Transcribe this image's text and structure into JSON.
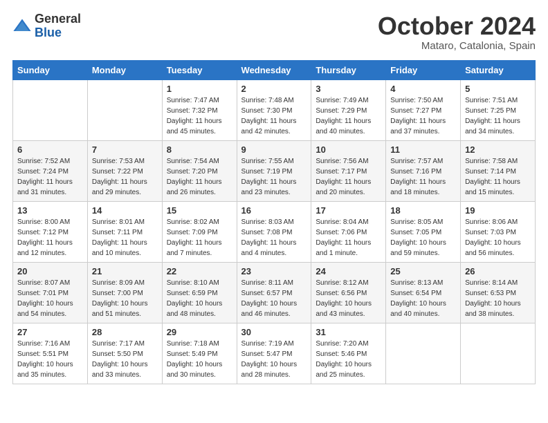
{
  "logo": {
    "general": "General",
    "blue": "Blue"
  },
  "header": {
    "month": "October 2024",
    "location": "Mataro, Catalonia, Spain"
  },
  "weekdays": [
    "Sunday",
    "Monday",
    "Tuesday",
    "Wednesday",
    "Thursday",
    "Friday",
    "Saturday"
  ],
  "weeks": [
    [
      {
        "day": "",
        "sunrise": "",
        "sunset": "",
        "daylight": ""
      },
      {
        "day": "",
        "sunrise": "",
        "sunset": "",
        "daylight": ""
      },
      {
        "day": "1",
        "sunrise": "Sunrise: 7:47 AM",
        "sunset": "Sunset: 7:32 PM",
        "daylight": "Daylight: 11 hours and 45 minutes."
      },
      {
        "day": "2",
        "sunrise": "Sunrise: 7:48 AM",
        "sunset": "Sunset: 7:30 PM",
        "daylight": "Daylight: 11 hours and 42 minutes."
      },
      {
        "day": "3",
        "sunrise": "Sunrise: 7:49 AM",
        "sunset": "Sunset: 7:29 PM",
        "daylight": "Daylight: 11 hours and 40 minutes."
      },
      {
        "day": "4",
        "sunrise": "Sunrise: 7:50 AM",
        "sunset": "Sunset: 7:27 PM",
        "daylight": "Daylight: 11 hours and 37 minutes."
      },
      {
        "day": "5",
        "sunrise": "Sunrise: 7:51 AM",
        "sunset": "Sunset: 7:25 PM",
        "daylight": "Daylight: 11 hours and 34 minutes."
      }
    ],
    [
      {
        "day": "6",
        "sunrise": "Sunrise: 7:52 AM",
        "sunset": "Sunset: 7:24 PM",
        "daylight": "Daylight: 11 hours and 31 minutes."
      },
      {
        "day": "7",
        "sunrise": "Sunrise: 7:53 AM",
        "sunset": "Sunset: 7:22 PM",
        "daylight": "Daylight: 11 hours and 29 minutes."
      },
      {
        "day": "8",
        "sunrise": "Sunrise: 7:54 AM",
        "sunset": "Sunset: 7:20 PM",
        "daylight": "Daylight: 11 hours and 26 minutes."
      },
      {
        "day": "9",
        "sunrise": "Sunrise: 7:55 AM",
        "sunset": "Sunset: 7:19 PM",
        "daylight": "Daylight: 11 hours and 23 minutes."
      },
      {
        "day": "10",
        "sunrise": "Sunrise: 7:56 AM",
        "sunset": "Sunset: 7:17 PM",
        "daylight": "Daylight: 11 hours and 20 minutes."
      },
      {
        "day": "11",
        "sunrise": "Sunrise: 7:57 AM",
        "sunset": "Sunset: 7:16 PM",
        "daylight": "Daylight: 11 hours and 18 minutes."
      },
      {
        "day": "12",
        "sunrise": "Sunrise: 7:58 AM",
        "sunset": "Sunset: 7:14 PM",
        "daylight": "Daylight: 11 hours and 15 minutes."
      }
    ],
    [
      {
        "day": "13",
        "sunrise": "Sunrise: 8:00 AM",
        "sunset": "Sunset: 7:12 PM",
        "daylight": "Daylight: 11 hours and 12 minutes."
      },
      {
        "day": "14",
        "sunrise": "Sunrise: 8:01 AM",
        "sunset": "Sunset: 7:11 PM",
        "daylight": "Daylight: 11 hours and 10 minutes."
      },
      {
        "day": "15",
        "sunrise": "Sunrise: 8:02 AM",
        "sunset": "Sunset: 7:09 PM",
        "daylight": "Daylight: 11 hours and 7 minutes."
      },
      {
        "day": "16",
        "sunrise": "Sunrise: 8:03 AM",
        "sunset": "Sunset: 7:08 PM",
        "daylight": "Daylight: 11 hours and 4 minutes."
      },
      {
        "day": "17",
        "sunrise": "Sunrise: 8:04 AM",
        "sunset": "Sunset: 7:06 PM",
        "daylight": "Daylight: 11 hours and 1 minute."
      },
      {
        "day": "18",
        "sunrise": "Sunrise: 8:05 AM",
        "sunset": "Sunset: 7:05 PM",
        "daylight": "Daylight: 10 hours and 59 minutes."
      },
      {
        "day": "19",
        "sunrise": "Sunrise: 8:06 AM",
        "sunset": "Sunset: 7:03 PM",
        "daylight": "Daylight: 10 hours and 56 minutes."
      }
    ],
    [
      {
        "day": "20",
        "sunrise": "Sunrise: 8:07 AM",
        "sunset": "Sunset: 7:01 PM",
        "daylight": "Daylight: 10 hours and 54 minutes."
      },
      {
        "day": "21",
        "sunrise": "Sunrise: 8:09 AM",
        "sunset": "Sunset: 7:00 PM",
        "daylight": "Daylight: 10 hours and 51 minutes."
      },
      {
        "day": "22",
        "sunrise": "Sunrise: 8:10 AM",
        "sunset": "Sunset: 6:59 PM",
        "daylight": "Daylight: 10 hours and 48 minutes."
      },
      {
        "day": "23",
        "sunrise": "Sunrise: 8:11 AM",
        "sunset": "Sunset: 6:57 PM",
        "daylight": "Daylight: 10 hours and 46 minutes."
      },
      {
        "day": "24",
        "sunrise": "Sunrise: 8:12 AM",
        "sunset": "Sunset: 6:56 PM",
        "daylight": "Daylight: 10 hours and 43 minutes."
      },
      {
        "day": "25",
        "sunrise": "Sunrise: 8:13 AM",
        "sunset": "Sunset: 6:54 PM",
        "daylight": "Daylight: 10 hours and 40 minutes."
      },
      {
        "day": "26",
        "sunrise": "Sunrise: 8:14 AM",
        "sunset": "Sunset: 6:53 PM",
        "daylight": "Daylight: 10 hours and 38 minutes."
      }
    ],
    [
      {
        "day": "27",
        "sunrise": "Sunrise: 7:16 AM",
        "sunset": "Sunset: 5:51 PM",
        "daylight": "Daylight: 10 hours and 35 minutes."
      },
      {
        "day": "28",
        "sunrise": "Sunrise: 7:17 AM",
        "sunset": "Sunset: 5:50 PM",
        "daylight": "Daylight: 10 hours and 33 minutes."
      },
      {
        "day": "29",
        "sunrise": "Sunrise: 7:18 AM",
        "sunset": "Sunset: 5:49 PM",
        "daylight": "Daylight: 10 hours and 30 minutes."
      },
      {
        "day": "30",
        "sunrise": "Sunrise: 7:19 AM",
        "sunset": "Sunset: 5:47 PM",
        "daylight": "Daylight: 10 hours and 28 minutes."
      },
      {
        "day": "31",
        "sunrise": "Sunrise: 7:20 AM",
        "sunset": "Sunset: 5:46 PM",
        "daylight": "Daylight: 10 hours and 25 minutes."
      },
      {
        "day": "",
        "sunrise": "",
        "sunset": "",
        "daylight": ""
      },
      {
        "day": "",
        "sunrise": "",
        "sunset": "",
        "daylight": ""
      }
    ]
  ]
}
